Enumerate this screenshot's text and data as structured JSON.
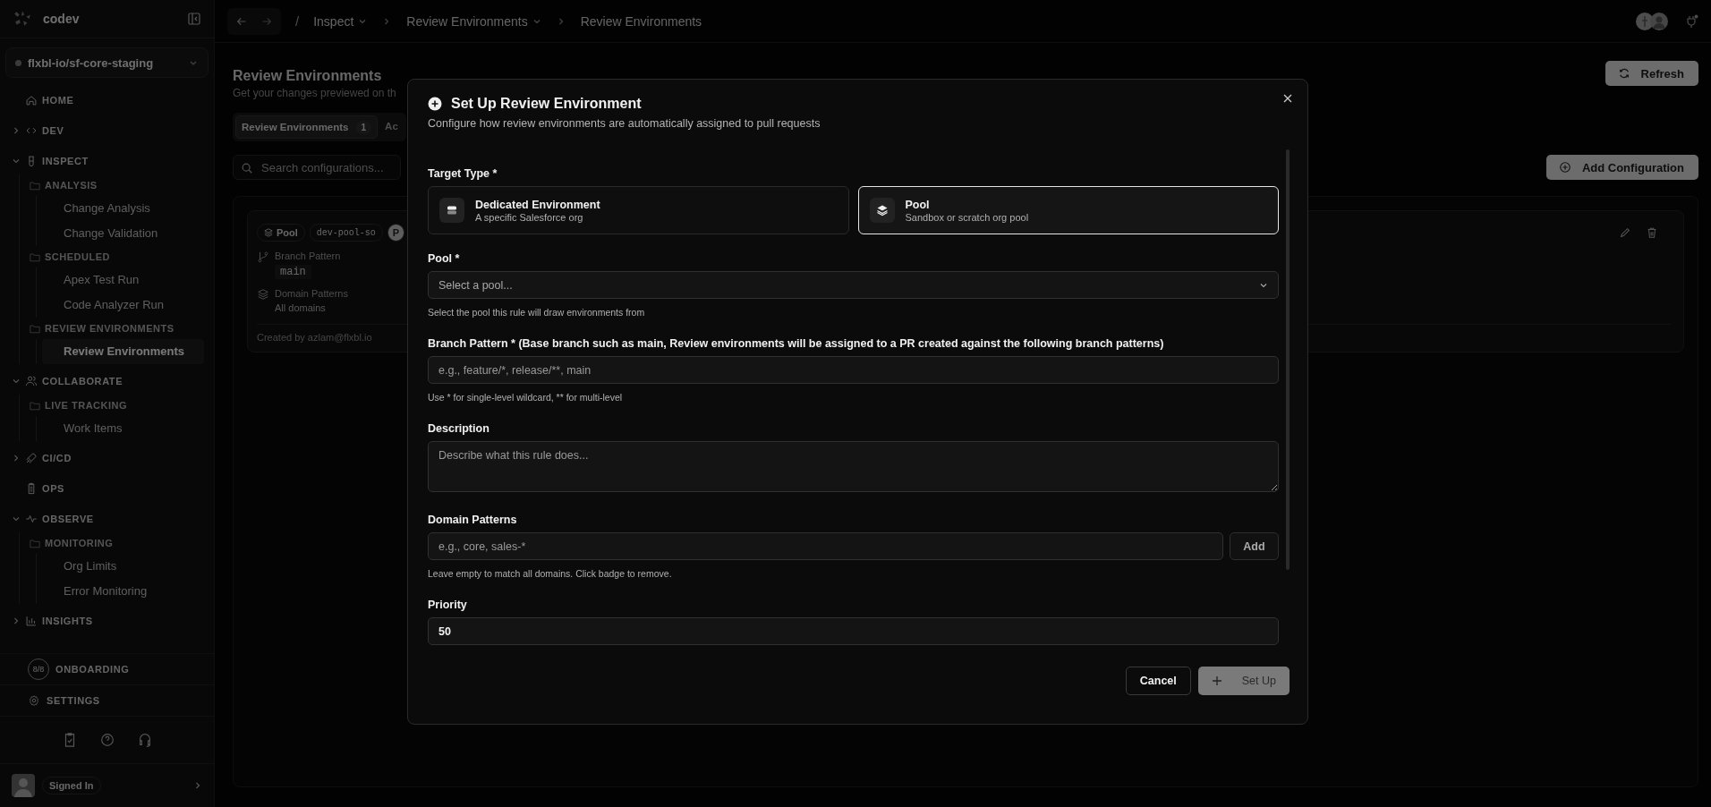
{
  "sidebar": {
    "brand": "codev",
    "workspace": "flxbl-io/sf-core-staging",
    "nav": [
      {
        "label": "HOME",
        "kind": "link"
      },
      {
        "label": "DEV",
        "kind": "section",
        "expanded": false
      },
      {
        "label": "INSPECT",
        "kind": "section",
        "expanded": true,
        "children": [
          {
            "label": "ANALYSIS",
            "children": [
              {
                "label": "Change Analysis",
                "selected": false
              },
              {
                "label": "Change Validation",
                "selected": false
              }
            ]
          },
          {
            "label": "SCHEDULED",
            "children": [
              {
                "label": "Apex Test Run",
                "selected": false
              },
              {
                "label": "Code Analyzer Run",
                "selected": false
              }
            ]
          },
          {
            "label": "REVIEW ENVIRONMENTS",
            "children": [
              {
                "label": "Review Environments",
                "selected": true
              }
            ]
          }
        ]
      },
      {
        "label": "COLLABORATE",
        "kind": "section",
        "expanded": true,
        "children": [
          {
            "label": "LIVE TRACKING",
            "children": [
              {
                "label": "Work Items",
                "selected": false
              }
            ]
          }
        ]
      },
      {
        "label": "CI/CD",
        "kind": "section",
        "expanded": false
      },
      {
        "label": "OPS",
        "kind": "link"
      },
      {
        "label": "OBSERVE",
        "kind": "section",
        "expanded": true,
        "children": [
          {
            "label": "MONITORING",
            "children": [
              {
                "label": "Org Limits",
                "selected": false
              },
              {
                "label": "Error Monitoring",
                "selected": false
              }
            ]
          }
        ]
      },
      {
        "label": "INSIGHTS",
        "kind": "section",
        "expanded": false
      }
    ],
    "onboarding": {
      "badge": "8/8",
      "label": "ONBOARDING"
    },
    "settings": "SETTINGS",
    "user": "Signed In"
  },
  "breadcrumbs": [
    {
      "label": "Inspect",
      "dropdown": true
    },
    {
      "label": "Review Environments",
      "dropdown": true
    },
    {
      "label": "Review Environments",
      "dropdown": false
    }
  ],
  "breadcrumb_root": "/",
  "page": {
    "title": "Review Environments",
    "subtitle": "Get your changes previewed on th",
    "refresh": "Refresh",
    "tabs": [
      {
        "label": "Review Environments",
        "count": "1",
        "selected": true
      },
      {
        "label": "Ac",
        "selected": false
      }
    ],
    "search": {
      "placeholder": "Search configurations..."
    },
    "add_button": "Add Configuration",
    "card": {
      "chips": [
        "Pool",
        "dev-pool-so",
        "P"
      ],
      "branch_label": "Branch Pattern",
      "branch": "main",
      "domain_label": "Domain Patterns",
      "domain": "All domains",
      "footer": "Created by azlam@flxbl.io"
    }
  },
  "dialog": {
    "title": "Set Up Review Environment",
    "subtitle": "Configure how review environments are automatically assigned to pull requests",
    "target_label": "Target Type *",
    "targets": [
      {
        "kind": "dedicated",
        "title": "Dedicated Environment",
        "subtitle": "A specific Salesforce org",
        "selected": false
      },
      {
        "kind": "pool",
        "title": "Pool",
        "subtitle": "Sandbox or scratch org pool",
        "selected": true
      }
    ],
    "pool": {
      "label": "Pool *",
      "placeholder": "Select a pool...",
      "hint": "Select the pool this rule will draw environments from"
    },
    "branch": {
      "label": "Branch Pattern * (Base branch such as main, Review environments will be assigned to a PR created against the following branch patterns)",
      "placeholder": "e.g., feature/*, release/**, main",
      "hint": "Use * for single-level wildcard, ** for multi-level"
    },
    "description": {
      "label": "Description",
      "placeholder": "Describe what this rule does..."
    },
    "domains": {
      "label": "Domain Patterns",
      "placeholder": "e.g., core, sales-*",
      "add": "Add",
      "hint": "Leave empty to match all domains. Click badge to remove."
    },
    "priority": {
      "label": "Priority",
      "value": "50"
    },
    "cancel": "Cancel",
    "submit": {
      "label": "Set Up",
      "disabled": true
    }
  }
}
